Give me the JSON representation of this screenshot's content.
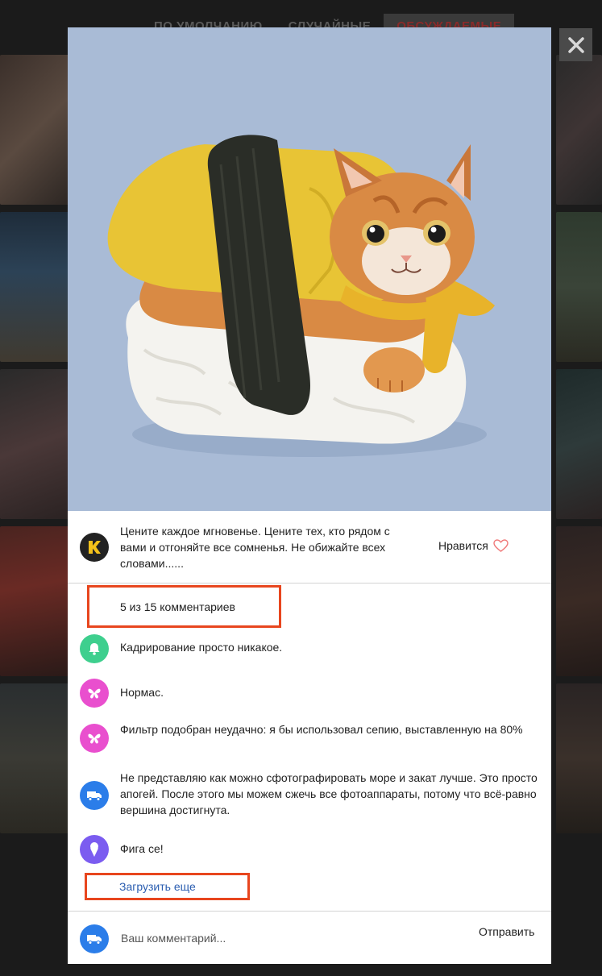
{
  "filter_tabs": [
    {
      "label": "ПО УМОЛЧАНИЮ",
      "active": false
    },
    {
      "label": "СЛУЧАЙНЫЕ",
      "active": false
    },
    {
      "label": "ОБСУЖДАЕМЫЕ",
      "active": true
    }
  ],
  "close_icon": "close-icon",
  "post": {
    "author_icon": "k-logo-icon",
    "text": "Цените каждое мгновенье. Цените тех, кто рядом с вами и отгоняйте все сомненья. Не обижайте всех словами......",
    "like_label": "Нравится",
    "like_icon": "heart-icon"
  },
  "comments_count_label": "5 из 15 комментариев",
  "comments": [
    {
      "avatar_icon": "bell-icon",
      "avatar_color": "#3ecf8e",
      "text": "Кадрирование просто никакое."
    },
    {
      "avatar_icon": "butterfly-icon",
      "avatar_color": "#e94fce",
      "text": "Нормас."
    },
    {
      "avatar_icon": "butterfly-icon",
      "avatar_color": "#e94fce",
      "text": "Фильтр подобран неудачно: я бы использовал сепию, выставленную на 80%"
    },
    {
      "avatar_icon": "truck-icon",
      "avatar_color": "#2b7de9",
      "text": "Не представляю как можно сфотографировать море и закат лучше. Это просто апогей. После этого мы можем сжечь все фотоаппараты, потому что всё-равно вершина достигнута."
    },
    {
      "avatar_icon": "icecream-icon",
      "avatar_color": "#7b5cf0",
      "text": "Фига се!"
    }
  ],
  "load_more_label": "Загрузить еще",
  "composer": {
    "avatar_icon": "truck-icon",
    "placeholder": "Ваш комментарий...",
    "send_label": "Отправить"
  },
  "colors": {
    "highlight": "#e8461e",
    "link": "#2a5db0",
    "photo_bg": "#a9bbd6"
  }
}
